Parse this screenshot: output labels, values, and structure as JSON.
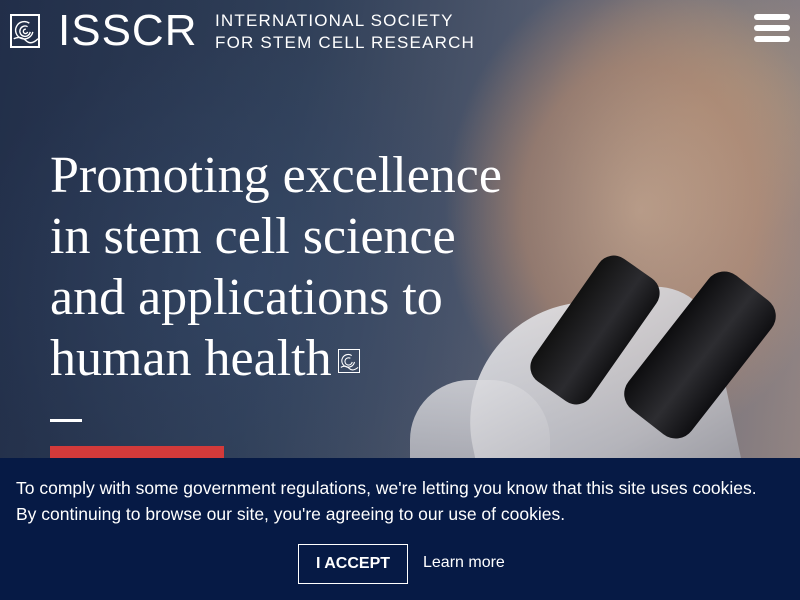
{
  "header": {
    "logo_acronym": "ISSCR",
    "logo_line1": "INTERNATIONAL SOCIETY",
    "logo_line2": "FOR STEM CELL RESEARCH",
    "menu_icon": "hamburger-menu-icon"
  },
  "hero": {
    "headline_lines": [
      "Promoting excellence",
      "in stem cell science",
      "and applications to",
      "human health"
    ]
  },
  "cookie_banner": {
    "line1": "To comply with some government regulations, we're letting you know that this site uses cookies.",
    "line2": "By continuing to browse our site, you're agreeing to our use of cookies.",
    "accept_label": "I ACCEPT",
    "learn_more_label": "Learn more"
  },
  "colors": {
    "banner_bg": "#061a45",
    "cta_red": "#d33a3a",
    "text": "#ffffff"
  }
}
